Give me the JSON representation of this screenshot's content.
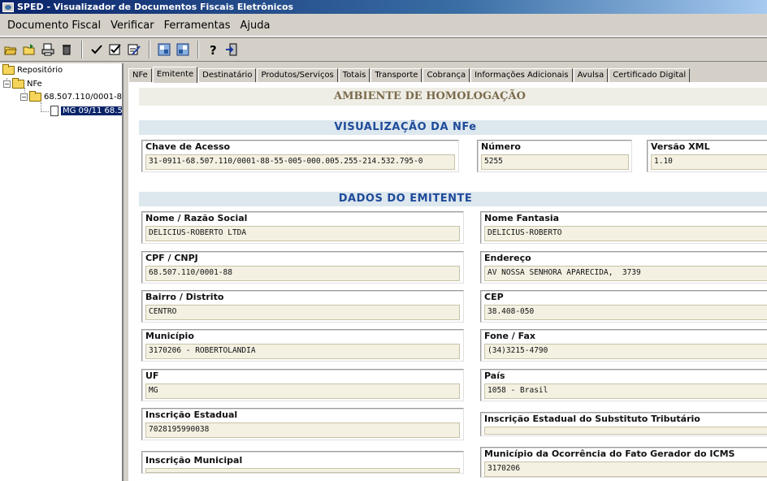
{
  "window": {
    "title": "SPED - Visualizador de Documentos Fiscais Eletrônicos"
  },
  "menu": [
    "Documento Fiscal",
    "Verificar",
    "Ferramentas",
    "Ajuda"
  ],
  "toolbar_icons": [
    "open-folder-icon",
    "open-folder-icon",
    "print-preview-icon",
    "trash-icon",
    "checkmark-icon",
    "check-box-icon",
    "sign-document-icon",
    "config-icon",
    "config-icon",
    "help-icon",
    "exit-icon"
  ],
  "tree": {
    "root": "Repositório",
    "nfe": "NFe",
    "cnpj": "68.507.110/0001-8",
    "doc": "MG 09/11 68.5"
  },
  "tabs": [
    "NFe",
    "Emitente",
    "Destinatário",
    "Produtos/Serviços",
    "Totais",
    "Transporte",
    "Cobrança",
    "Informações Adicionais",
    "Avulsa",
    "Certificado Digital"
  ],
  "active_tab": "Emitente",
  "ambiente": "AMBIENTE DE HOMOLOGAÇÃO",
  "visualizacao": {
    "title": "VISUALIZAÇÃO DA NFe",
    "chave_label": "Chave de Acesso",
    "chave_value": "31-0911-68.507.110/0001-88-55-005-000.005.255-214.532.795-0",
    "numero_label": "Número",
    "numero_value": "5255",
    "versao_label": "Versão XML",
    "versao_value": "1.10"
  },
  "emitente": {
    "title": "DADOS DO EMITENTE",
    "nome_label": "Nome / Razão Social",
    "nome_value": "DELICIUS-ROBERTO LTDA",
    "fantasia_label": "Nome Fantasia",
    "fantasia_value": "DELICIUS-ROBERTO",
    "cnpj_label": "CPF / CNPJ",
    "cnpj_value": "68.507.110/0001-88",
    "endereco_label": "Endereço",
    "endereco_value": "AV NOSSA SENHORA APARECIDA,  3739",
    "bairro_label": "Bairro / Distrito",
    "bairro_value": "CENTRO",
    "cep_label": "CEP",
    "cep_value": "38.408-050",
    "municipio_label": "Município",
    "municipio_value": "3170206 - ROBERTOLANDIA",
    "fone_label": "Fone / Fax",
    "fone_value": "(34)3215-4790",
    "uf_label": "UF",
    "uf_value": "MG",
    "pais_label": "País",
    "pais_value": "1058 - Brasil",
    "ie_label": "Inscrição Estadual",
    "ie_value": "7028195990038",
    "iest_label": "Inscrição Estadual do Substituto Tributário",
    "iest_value": "",
    "im_label": "Inscrição Municipal",
    "im_value": "",
    "mfg_label": "Município da Ocorrência do Fato Gerador do ICMS",
    "mfg_value": "3170206"
  }
}
